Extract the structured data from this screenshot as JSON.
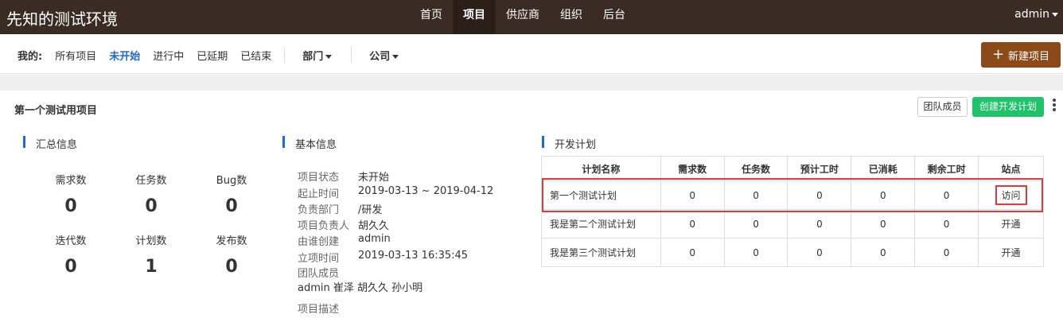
{
  "header": {
    "brand": "先知的测试环境",
    "nav": [
      "首页",
      "项目",
      "供应商",
      "组织",
      "后台"
    ],
    "user": "admin"
  },
  "filters": {
    "label": "我的:",
    "items": [
      "所有项目",
      "未开始",
      "进行中",
      "已延期",
      "已结束"
    ],
    "dept": "部门",
    "company": "公司",
    "new_project": "新建项目"
  },
  "project": {
    "title": "第一个测试用项目",
    "team_button": "团队成员",
    "create_plan_button": "创建开发计划"
  },
  "summary": {
    "title": "汇总信息",
    "stats": [
      {
        "label": "需求数",
        "value": "0"
      },
      {
        "label": "任务数",
        "value": "0"
      },
      {
        "label": "Bug数",
        "value": "0"
      },
      {
        "label": "迭代数",
        "value": "0"
      },
      {
        "label": "计划数",
        "value": "1"
      },
      {
        "label": "发布数",
        "value": "0"
      }
    ]
  },
  "basic": {
    "title": "基本信息",
    "rows": [
      {
        "k": "项目状态",
        "v": "未开始"
      },
      {
        "k": "起止时间",
        "v": "2019-03-13 ~ 2019-04-12"
      },
      {
        "k": "负责部门",
        "v": "/研发"
      },
      {
        "k": "项目负责人",
        "v": "胡久久"
      },
      {
        "k": "由谁创建",
        "v": "admin"
      },
      {
        "k": "立项时间",
        "v": "2019-03-13 16:35:45"
      }
    ],
    "team_label": "团队成员",
    "team_members": "admin 崔泽 胡久久 孙小明",
    "desc_label": "项目描述"
  },
  "plan": {
    "title": "开发计划",
    "columns": [
      "计划名称",
      "需求数",
      "任务数",
      "预计工时",
      "已消耗",
      "剩余工时",
      "站点"
    ],
    "rows": [
      [
        "第一个测试计划",
        "0",
        "0",
        "0",
        "0",
        "0",
        "访问"
      ],
      [
        "我是第二个测试计划",
        "0",
        "0",
        "0",
        "0",
        "0",
        "开通"
      ],
      [
        "我是第三个测试计划",
        "0",
        "0",
        "0",
        "0",
        "0",
        "开通"
      ]
    ]
  },
  "colors": {
    "topbar": "#3b2c23",
    "accent_blue": "#1f6ad2",
    "new_button": "#8b4a18",
    "green_button": "#21c36a",
    "highlight_red": "#e4393c"
  }
}
